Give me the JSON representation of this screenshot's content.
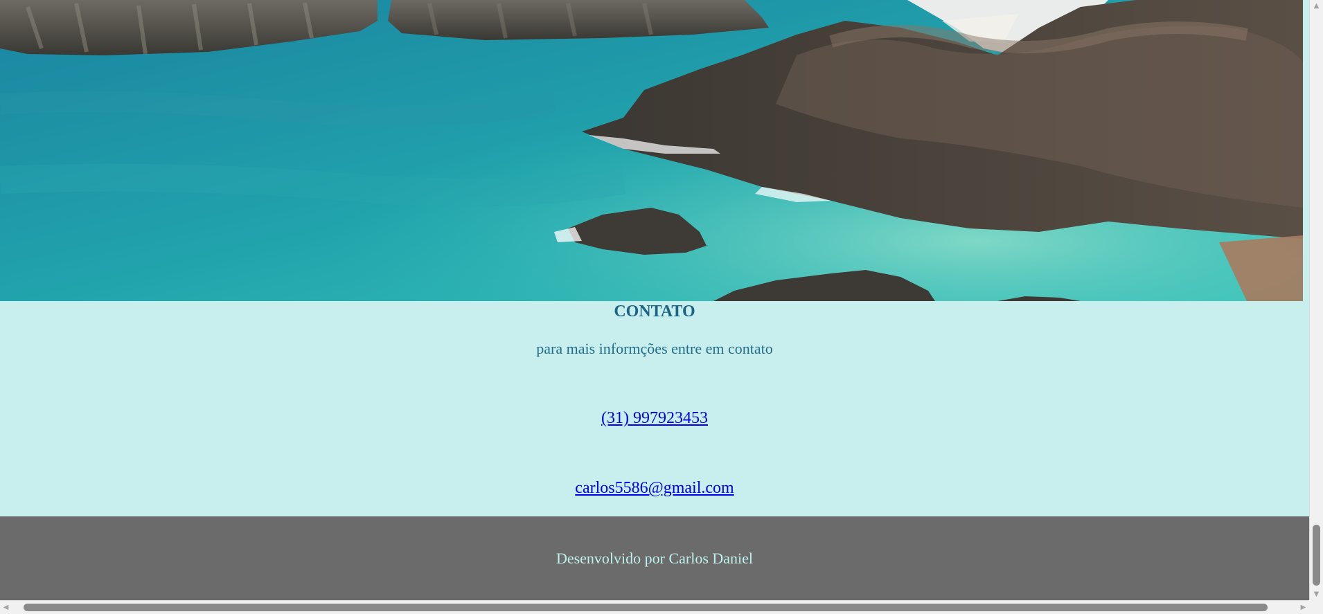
{
  "hero": {
    "image_name": "coastal-landscape-image"
  },
  "contact": {
    "title": "CONTATO",
    "subtitle": "para mais informções entre em contato",
    "phone": "(31) 997923453",
    "email": "carlos5586@gmail.com"
  },
  "footer": {
    "text": "Desenvolvido por Carlos Daniel"
  },
  "colors": {
    "background": "#c8eeee",
    "heading": "#1a6488",
    "link": "#0000ee",
    "footer_bg": "#6b6b6b",
    "footer_text": "#bff0ee"
  },
  "scrollbars": {
    "up_icon": "triangle-up-icon",
    "down_icon": "triangle-down-icon",
    "left_icon": "triangle-left-icon",
    "right_icon": "triangle-right-icon"
  }
}
